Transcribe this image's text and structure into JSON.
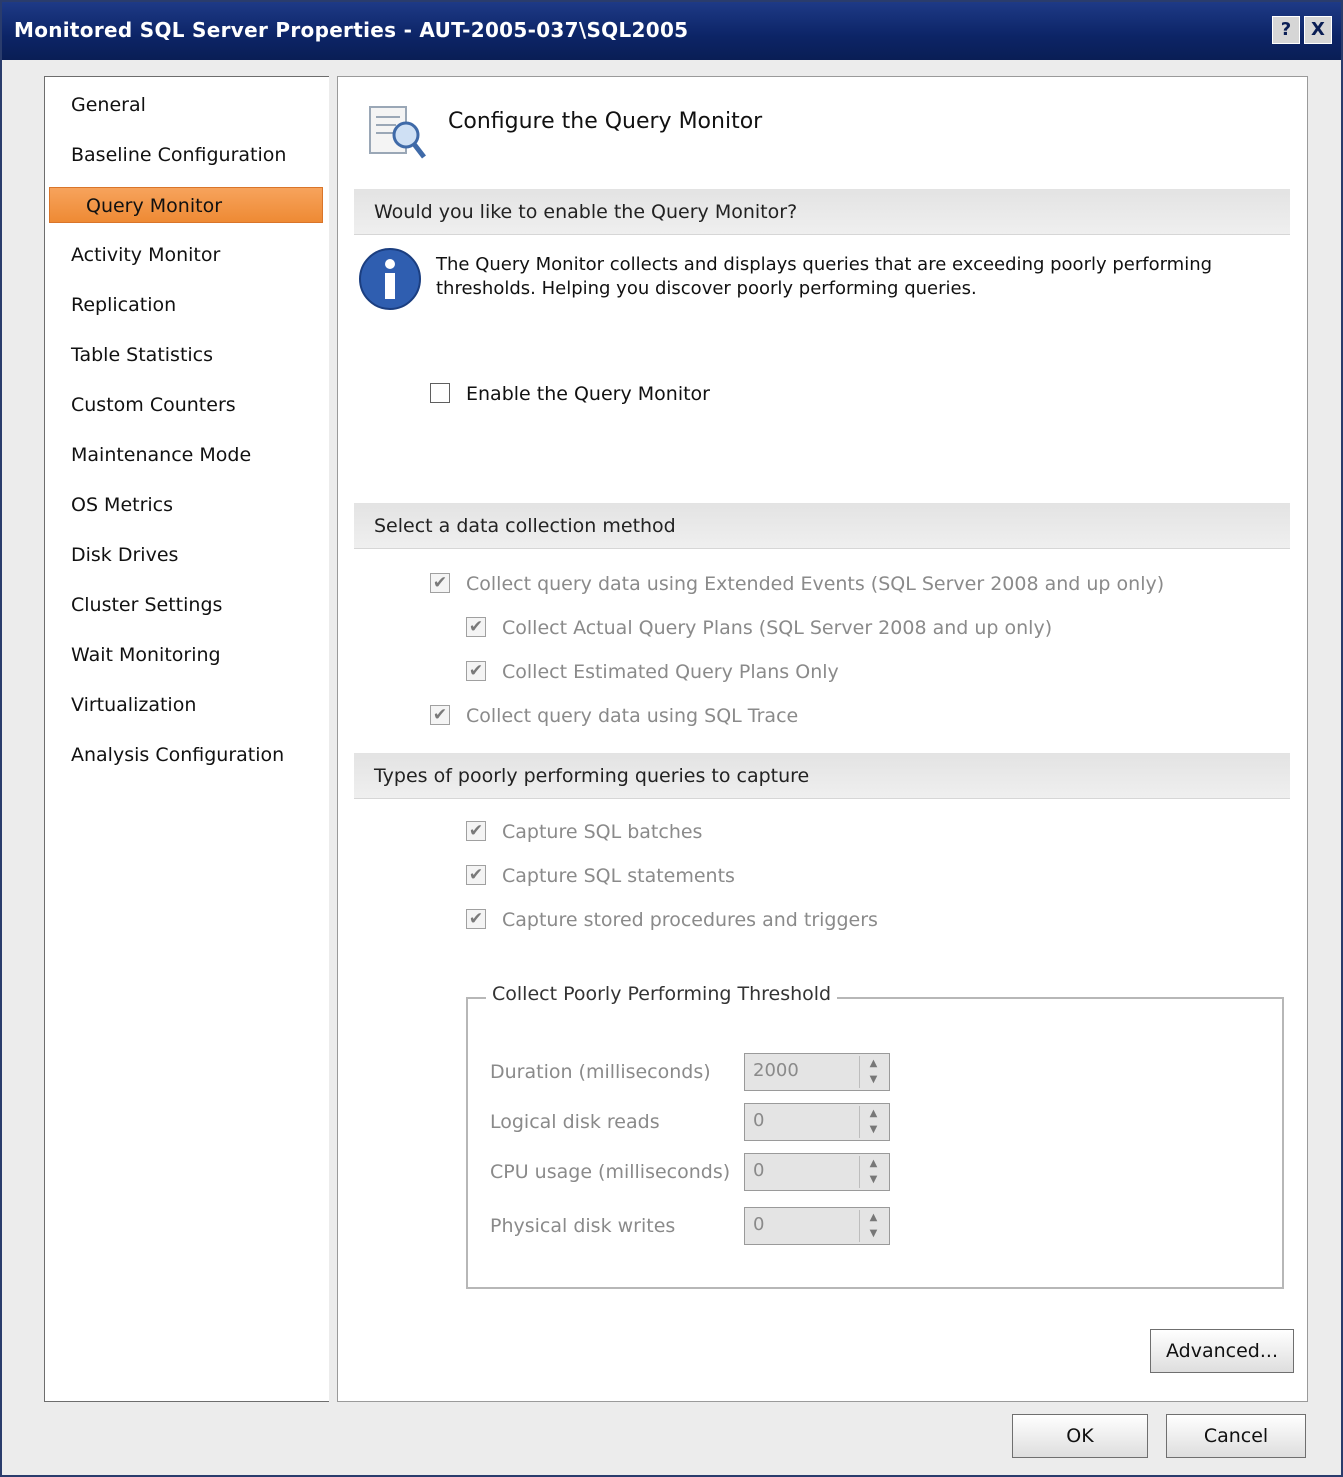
{
  "window": {
    "title": "Monitored SQL Server Properties - AUT-2005-037\\SQL2005",
    "help_label": "?",
    "close_label": "X"
  },
  "sidebar": {
    "items": [
      {
        "label": "General"
      },
      {
        "label": "Baseline Configuration"
      },
      {
        "label": "Query Monitor"
      },
      {
        "label": "Activity Monitor"
      },
      {
        "label": "Replication"
      },
      {
        "label": "Table Statistics"
      },
      {
        "label": "Custom Counters"
      },
      {
        "label": "Maintenance Mode"
      },
      {
        "label": "OS Metrics"
      },
      {
        "label": "Disk Drives"
      },
      {
        "label": "Cluster Settings"
      },
      {
        "label": "Wait Monitoring"
      },
      {
        "label": "Virtualization"
      },
      {
        "label": "Analysis Configuration"
      }
    ],
    "selected_index": 2
  },
  "main": {
    "page_title": "Configure the Query Monitor",
    "section_enable": "Would you like to enable the Query Monitor?",
    "info_text": "The Query Monitor collects and displays queries that are exceeding poorly performing thresholds. Helping you discover poorly performing queries.",
    "enable_checkbox": {
      "label": "Enable the Query Monitor",
      "checked": false
    },
    "section_collect": "Select a data collection method",
    "collect_options": [
      {
        "label": "Collect query data using Extended Events (SQL Server 2008 and up only)",
        "checked": true,
        "indent": false
      },
      {
        "label": "Collect Actual Query Plans (SQL Server 2008 and up only)",
        "checked": true,
        "indent": true
      },
      {
        "label": "Collect Estimated Query Plans Only",
        "checked": true,
        "indent": true
      },
      {
        "label": "Collect query data using SQL Trace",
        "checked": true,
        "indent": false
      }
    ],
    "section_capture": "Types of poorly performing queries to capture",
    "capture_options": [
      {
        "label": "Capture SQL batches",
        "checked": true
      },
      {
        "label": "Capture SQL statements",
        "checked": true
      },
      {
        "label": "Capture stored procedures and triggers",
        "checked": true
      }
    ],
    "threshold": {
      "legend": "Collect Poorly Performing Threshold",
      "fields": [
        {
          "label": "Duration (milliseconds)",
          "value": "2000"
        },
        {
          "label": "Logical disk reads",
          "value": "0"
        },
        {
          "label": "CPU usage (milliseconds)",
          "value": "0"
        },
        {
          "label": "Physical disk writes",
          "value": "0"
        }
      ]
    },
    "advanced_button": "Advanced..."
  },
  "footer": {
    "ok_button": "OK",
    "cancel_button": "Cancel"
  },
  "colors": {
    "titlebar": "#0c2466",
    "selected_nav": "#ee8a34"
  }
}
